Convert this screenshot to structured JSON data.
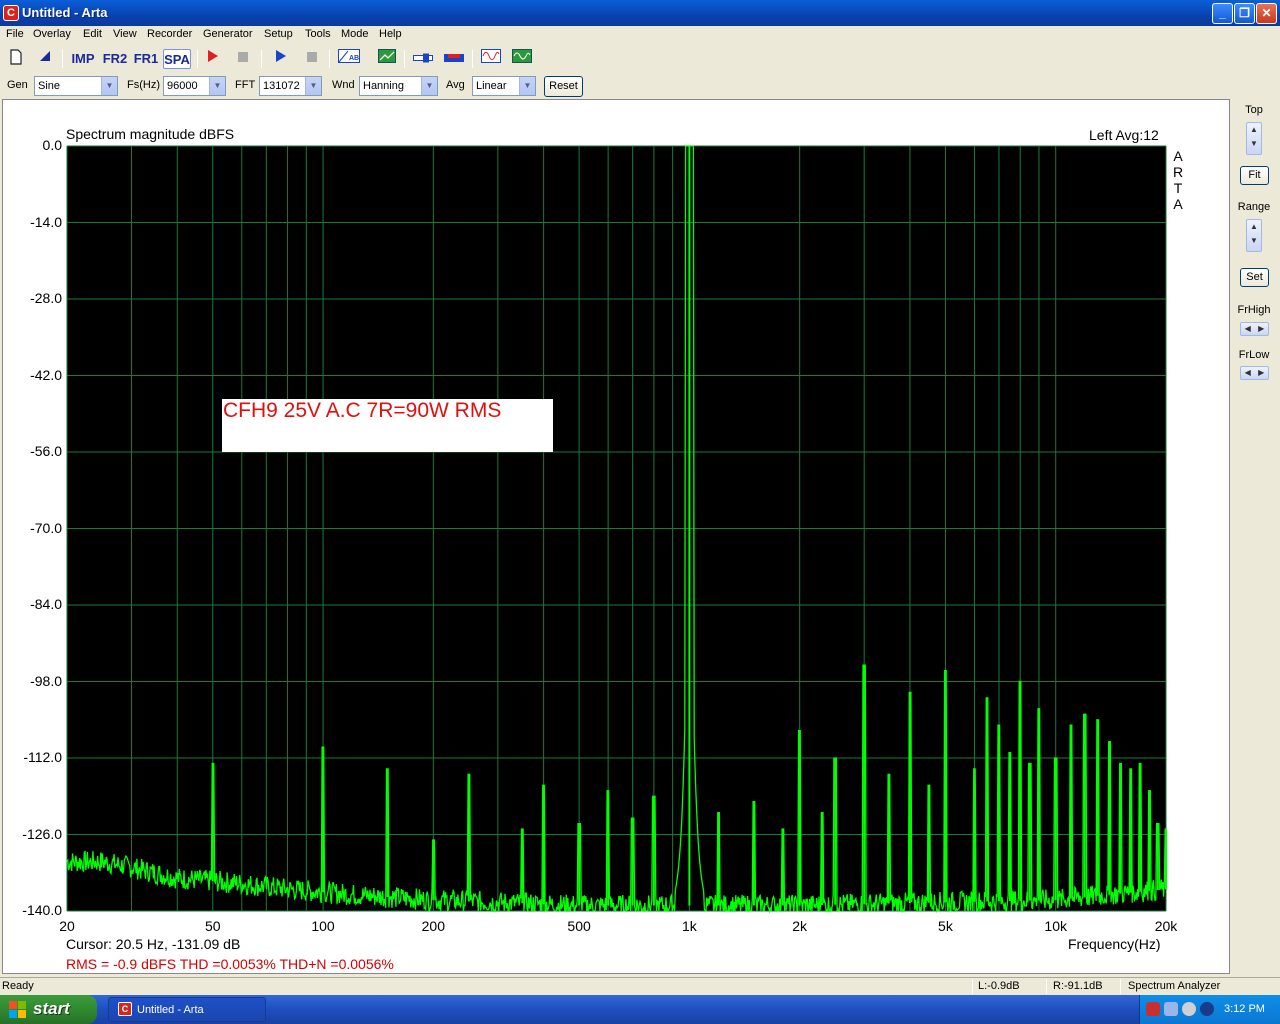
{
  "window": {
    "title": "Untitled - Arta",
    "minimize": "_",
    "restore": "❐",
    "close": "✕"
  },
  "menu": [
    "File",
    "Overlay",
    "Edit",
    "View",
    "Recorder",
    "Generator",
    "Setup",
    "Tools",
    "Mode",
    "Help"
  ],
  "toolbar": {
    "imp": "IMP",
    "fr2": "FR2",
    "fr1": "FR1",
    "spa": "SPA"
  },
  "options": {
    "gen_label": "Gen",
    "gen_value": "Sine",
    "fs_label": "Fs(Hz)",
    "fs_value": "96000",
    "fft_label": "FFT",
    "fft_value": "131072",
    "wnd_label": "Wnd",
    "wnd_value": "Hanning",
    "avg_label": "Avg",
    "avg_value": "Linear",
    "reset_label": "Reset"
  },
  "plot": {
    "title": "Spectrum magnitude dBFS",
    "channel_avg": "Left  Avg:12",
    "brand": [
      "A",
      "R",
      "T",
      "A"
    ],
    "annotation": "CFH9 25V A.C 7R=90W RMS",
    "cursor": "Cursor:    20.5 Hz, -131.09 dB",
    "stats": "RMS =   -0.9 dBFS   THD =0.0053%   THD+N =0.0056%",
    "xaxis_title": "Frequency(Hz)"
  },
  "side": {
    "top_label": "Top",
    "fit_label": "Fit",
    "range_label": "Range",
    "set_label": "Set",
    "frhigh_label": "FrHigh",
    "frlow_label": "FrLow"
  },
  "chart_data": {
    "type": "line",
    "title": "Spectrum magnitude dBFS",
    "xlabel": "Frequency(Hz)",
    "ylabel": "",
    "x_scale": "log",
    "xlim": [
      20,
      20000
    ],
    "ylim": [
      -140,
      0
    ],
    "grid": true,
    "background": "#000000",
    "line_color": "#00ff00",
    "grid_color": "#1a7a3a",
    "y_ticks": [
      "0.0",
      "-14.0",
      "-28.0",
      "-42.0",
      "-56.0",
      "-70.0",
      "-84.0",
      "-98.0",
      "-112.0",
      "-126.0",
      "-140.0"
    ],
    "x_ticks": [
      "20",
      "50",
      "100",
      "200",
      "500",
      "1k",
      "2k",
      "5k",
      "10k",
      "20k"
    ],
    "noise_floor": [
      {
        "x": 20,
        "y": -131
      },
      {
        "x": 25,
        "y": -131
      },
      {
        "x": 30,
        "y": -132
      },
      {
        "x": 40,
        "y": -134
      },
      {
        "x": 60,
        "y": -135
      },
      {
        "x": 80,
        "y": -136
      },
      {
        "x": 120,
        "y": -137
      },
      {
        "x": 200,
        "y": -138
      },
      {
        "x": 500,
        "y": -139
      },
      {
        "x": 2000,
        "y": -139
      },
      {
        "x": 10000,
        "y": -138
      },
      {
        "x": 20000,
        "y": -136
      }
    ],
    "peaks": [
      {
        "x": 50,
        "y": -113
      },
      {
        "x": 100,
        "y": -110
      },
      {
        "x": 150,
        "y": -114
      },
      {
        "x": 200,
        "y": -127
      },
      {
        "x": 250,
        "y": -115
      },
      {
        "x": 350,
        "y": -125
      },
      {
        "x": 400,
        "y": -117
      },
      {
        "x": 500,
        "y": -124
      },
      {
        "x": 600,
        "y": -118
      },
      {
        "x": 700,
        "y": -123
      },
      {
        "x": 800,
        "y": -119
      },
      {
        "x": 1000,
        "y": 0
      },
      {
        "x": 1200,
        "y": -122
      },
      {
        "x": 1500,
        "y": -120
      },
      {
        "x": 1800,
        "y": -125
      },
      {
        "x": 2000,
        "y": -107
      },
      {
        "x": 2300,
        "y": -122
      },
      {
        "x": 2500,
        "y": -112
      },
      {
        "x": 3000,
        "y": -95
      },
      {
        "x": 3500,
        "y": -115
      },
      {
        "x": 4000,
        "y": -100
      },
      {
        "x": 4500,
        "y": -117
      },
      {
        "x": 5000,
        "y": -96
      },
      {
        "x": 6000,
        "y": -114
      },
      {
        "x": 6500,
        "y": -101
      },
      {
        "x": 7000,
        "y": -106
      },
      {
        "x": 7500,
        "y": -111
      },
      {
        "x": 8000,
        "y": -98
      },
      {
        "x": 8500,
        "y": -113
      },
      {
        "x": 9000,
        "y": -103
      },
      {
        "x": 10000,
        "y": -112
      },
      {
        "x": 11000,
        "y": -106
      },
      {
        "x": 12000,
        "y": -104
      },
      {
        "x": 13000,
        "y": -105
      },
      {
        "x": 14000,
        "y": -109
      },
      {
        "x": 15000,
        "y": -113
      },
      {
        "x": 16000,
        "y": -114
      },
      {
        "x": 17000,
        "y": -113
      },
      {
        "x": 18000,
        "y": -118
      },
      {
        "x": 19000,
        "y": -124
      },
      {
        "x": 20000,
        "y": -125
      }
    ],
    "fundamental": {
      "x": 1000,
      "y": 0
    }
  },
  "status": {
    "ready": "Ready",
    "left_level": "L:-0.9dB",
    "right_level": "R:-91.1dB",
    "mode": "Spectrum Analyzer"
  },
  "taskbar": {
    "start": "start",
    "task": "Untitled - Arta",
    "clock": "3:12 PM"
  }
}
